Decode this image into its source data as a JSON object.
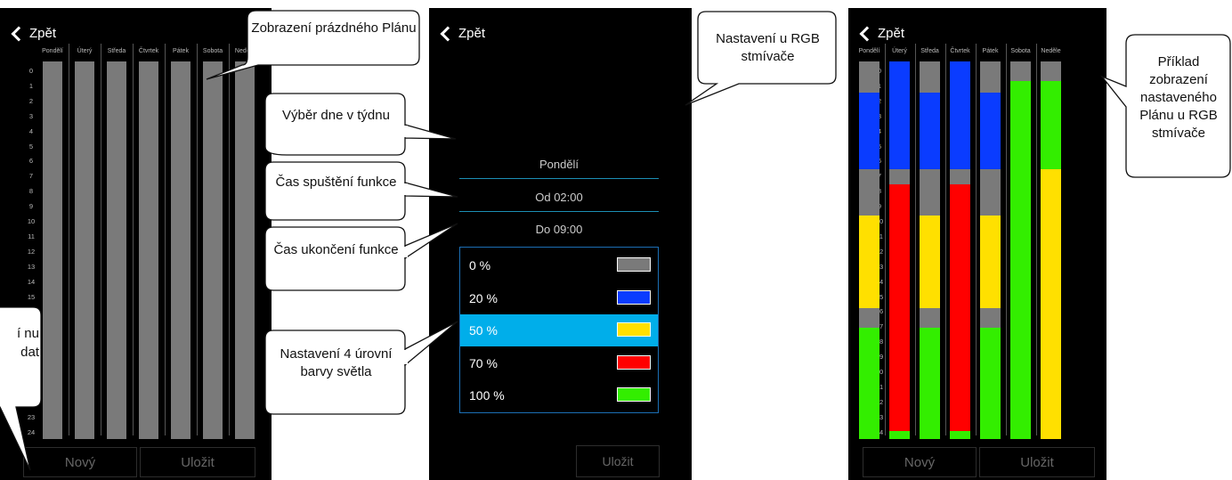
{
  "back_label": "Zpět",
  "days": [
    "Pondělí",
    "Úterý",
    "Středa",
    "Čtvrtek",
    "Pátek",
    "Sobota",
    "Neděle"
  ],
  "hours": [
    "0",
    "1",
    "2",
    "3",
    "4",
    "5",
    "6",
    "7",
    "8",
    "9",
    "10",
    "11",
    "12",
    "13",
    "14",
    "15",
    "16",
    "17",
    "18",
    "19",
    "20",
    "21",
    "22",
    "23",
    "24"
  ],
  "buttons": {
    "new": "Nový",
    "save": "Uložit"
  },
  "editor": {
    "day": "Pondělí",
    "from": "Od 02:00",
    "to": "Do 09:00",
    "levels": [
      {
        "label": "0 %",
        "color": "#7a7a7a"
      },
      {
        "label": "20 %",
        "color": "#0a3cff"
      },
      {
        "label": "50 %",
        "color": "#ffe000"
      },
      {
        "label": "70 %",
        "color": "#ff0000"
      },
      {
        "label": "100 %",
        "color": "#33ee00"
      }
    ],
    "selected_level": "50 %"
  },
  "empty_color": "#7a7a7a",
  "schedule": [
    [
      {
        "from": 0,
        "to": 2,
        "level": 0
      },
      {
        "from": 2,
        "to": 7,
        "level": 1
      },
      {
        "from": 7,
        "to": 10,
        "level": 0
      },
      {
        "from": 10,
        "to": 16,
        "level": 2
      },
      {
        "from": 16,
        "to": 17.3,
        "level": 0
      },
      {
        "from": 17.3,
        "to": 24.5,
        "level": 4
      }
    ],
    [
      {
        "from": 0,
        "to": 7,
        "level": 1
      },
      {
        "from": 7,
        "to": 8,
        "level": 0
      },
      {
        "from": 8,
        "to": 24,
        "level": 3
      },
      {
        "from": 24,
        "to": 24.5,
        "level": 4
      }
    ],
    [
      {
        "from": 0,
        "to": 2,
        "level": 0
      },
      {
        "from": 2,
        "to": 7,
        "level": 1
      },
      {
        "from": 7,
        "to": 10,
        "level": 0
      },
      {
        "from": 10,
        "to": 16,
        "level": 2
      },
      {
        "from": 16,
        "to": 17.3,
        "level": 0
      },
      {
        "from": 17.3,
        "to": 24.5,
        "level": 4
      }
    ],
    [
      {
        "from": 0,
        "to": 7,
        "level": 1
      },
      {
        "from": 7,
        "to": 8,
        "level": 0
      },
      {
        "from": 8,
        "to": 24,
        "level": 3
      },
      {
        "from": 24,
        "to": 24.5,
        "level": 4
      }
    ],
    [
      {
        "from": 0,
        "to": 2,
        "level": 0
      },
      {
        "from": 2,
        "to": 7,
        "level": 1
      },
      {
        "from": 7,
        "to": 10,
        "level": 0
      },
      {
        "from": 10,
        "to": 16,
        "level": 2
      },
      {
        "from": 16,
        "to": 17.3,
        "level": 0
      },
      {
        "from": 17.3,
        "to": 24.5,
        "level": 4
      }
    ],
    [
      {
        "from": 0,
        "to": 1.3,
        "level": 0
      },
      {
        "from": 1.3,
        "to": 24.5,
        "level": 4
      }
    ],
    [
      {
        "from": 0,
        "to": 1.3,
        "level": 0
      },
      {
        "from": 1.3,
        "to": 7,
        "level": 4
      },
      {
        "from": 7,
        "to": 24.5,
        "level": 2
      }
    ]
  ],
  "callouts": {
    "empty_plan": "Zobrazení prázdného Plánu",
    "rgb_setting": "Nastavení u RGB stmívače",
    "day_select": "Výběr dne v týdnu",
    "start_time": "Čas spuštění funkce",
    "end_time": "Čas ukončení funkce",
    "levels": "Nastavení 4 úrovní barvy světla",
    "example": "Příklad zobrazení nastaveného Plánu u RGB stmívače",
    "left_cut": "í nu dat"
  }
}
